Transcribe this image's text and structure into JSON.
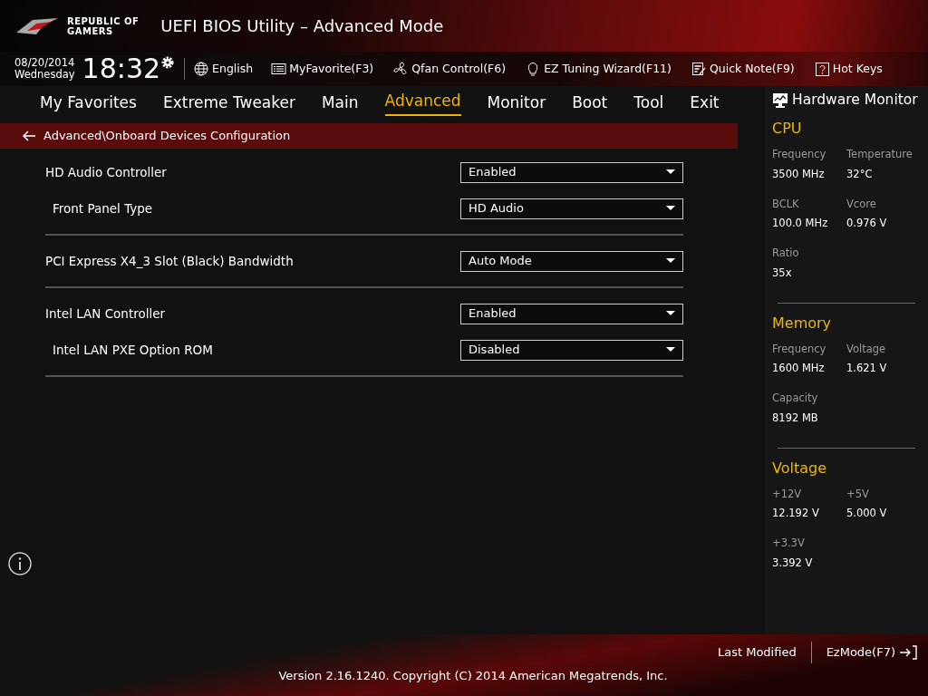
{
  "logo": {
    "line1": "REPUBLIC OF",
    "line2": "GAMERS"
  },
  "window": {
    "title": "UEFI BIOS Utility – Advanced Mode"
  },
  "clock": {
    "date": "08/20/2014",
    "day": "Wednesday",
    "time": "18:32"
  },
  "toolbar": [
    {
      "kind": "globe",
      "label": "English"
    },
    {
      "kind": "list",
      "label": "MyFavorite(F3)"
    },
    {
      "kind": "fan",
      "label": "Qfan Control(F6)"
    },
    {
      "kind": "bulb",
      "label": "EZ Tuning Wizard(F11)"
    },
    {
      "kind": "note",
      "label": "Quick Note(F9)"
    },
    {
      "kind": "help",
      "label": "Hot Keys"
    }
  ],
  "tabs": [
    {
      "label": "My Favorites",
      "selected": false
    },
    {
      "label": "Extreme Tweaker",
      "selected": false
    },
    {
      "label": "Main",
      "selected": false
    },
    {
      "label": "Advanced",
      "selected": true
    },
    {
      "label": "Monitor",
      "selected": false
    },
    {
      "label": "Boot",
      "selected": false
    },
    {
      "label": "Tool",
      "selected": false
    },
    {
      "label": "Exit",
      "selected": false
    }
  ],
  "breadcrumb": "Advanced\\Onboard Devices Configuration",
  "settings": [
    {
      "label": "HD Audio Controller",
      "value": "Enabled",
      "children": [
        {
          "label": "Front Panel Type",
          "value": "HD Audio"
        }
      ]
    },
    {
      "label": "PCI Express X4_3 Slot (Black) Bandwidth",
      "value": "Auto Mode"
    },
    {
      "label": "Intel LAN Controller",
      "value": "Enabled",
      "children": [
        {
          "label": "Intel LAN PXE Option ROM",
          "value": "Disabled"
        }
      ]
    }
  ],
  "hardware_monitor": {
    "title": "Hardware Monitor",
    "sections": [
      {
        "title": "CPU",
        "fields": [
          {
            "label": "Frequency",
            "value": "3500 MHz"
          },
          {
            "label": "Temperature",
            "value": "32°C"
          },
          {
            "label": "BCLK",
            "value": "100.0 MHz"
          },
          {
            "label": "Vcore",
            "value": "0.976 V"
          },
          {
            "label": "Ratio",
            "value": "35x"
          }
        ]
      },
      {
        "title": "Memory",
        "fields": [
          {
            "label": "Frequency",
            "value": "1600 MHz"
          },
          {
            "label": "Voltage",
            "value": "1.621 V"
          },
          {
            "label": "Capacity",
            "value": "8192 MB"
          }
        ]
      },
      {
        "title": "Voltage",
        "fields": [
          {
            "label": "+12V",
            "value": "12.192 V"
          },
          {
            "label": "+5V",
            "value": "5.000 V"
          },
          {
            "label": "+3.3V",
            "value": "3.392 V"
          }
        ]
      }
    ]
  },
  "footer": {
    "last_modified": "Last Modified",
    "ez_mode": "EzMode(F7)",
    "copyright": "Version 2.16.1240. Copyright (C) 2014 American Megatrends, Inc."
  }
}
